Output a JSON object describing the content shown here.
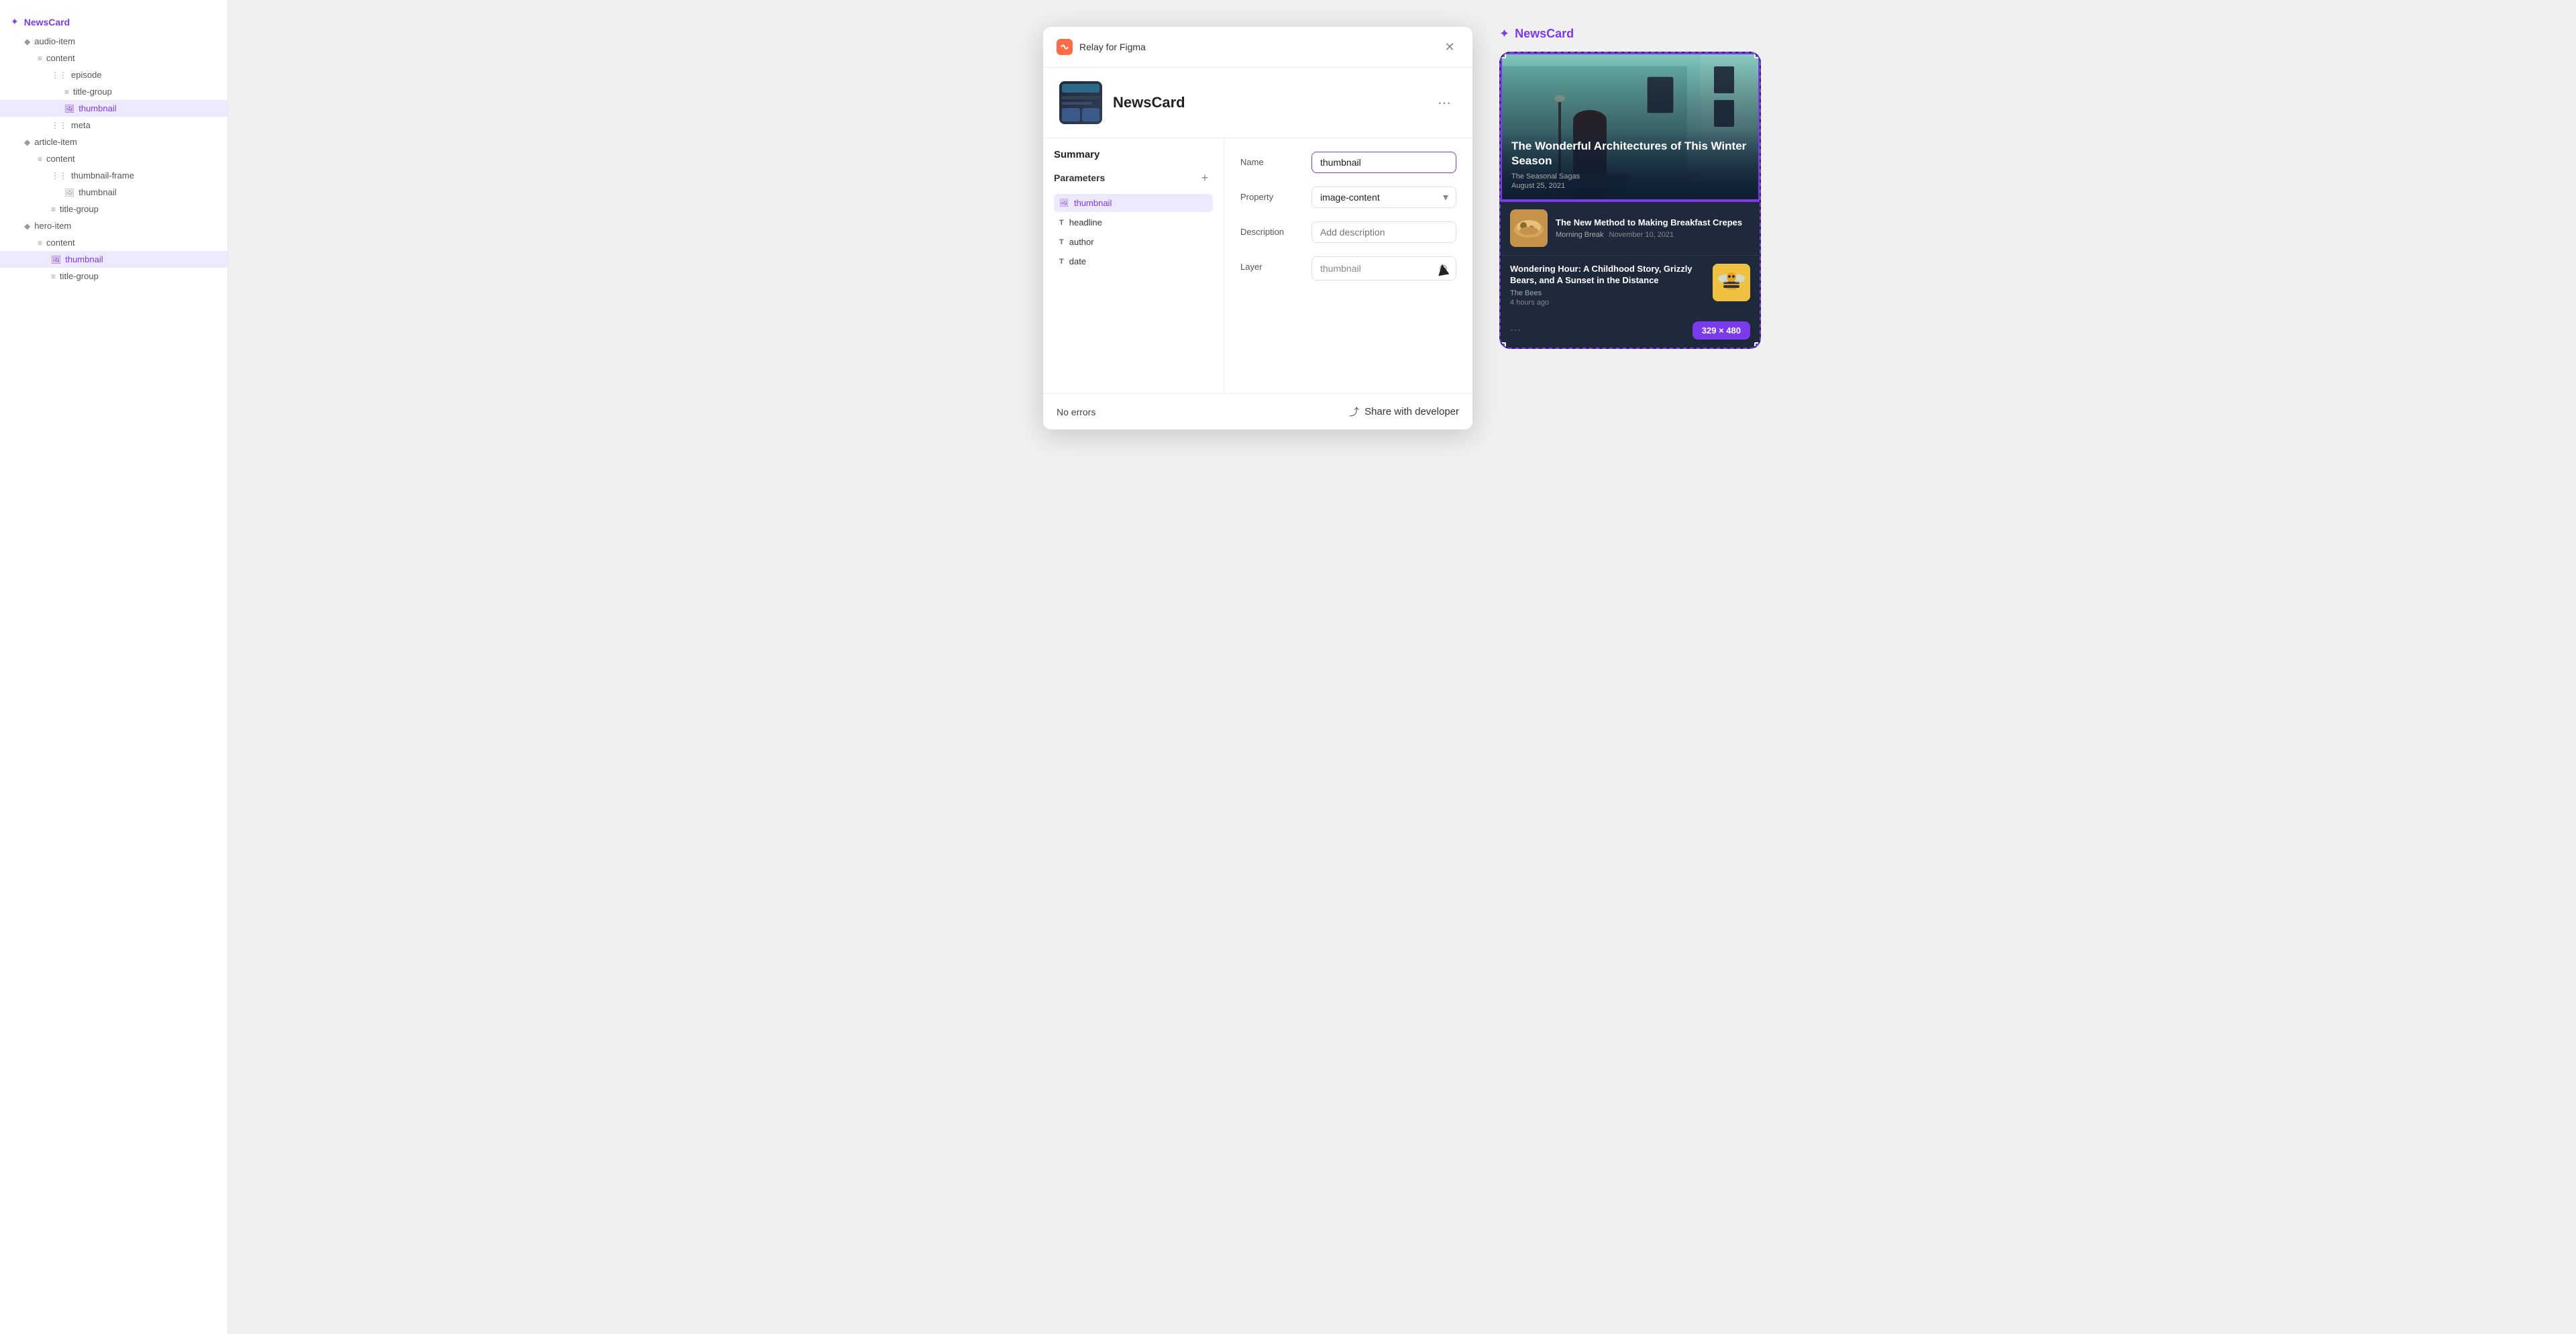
{
  "sidebar": {
    "root_label": "NewsCard",
    "items": [
      {
        "id": "audio-item",
        "label": "audio-item",
        "indent": 1,
        "icon_type": "diamond",
        "active": false
      },
      {
        "id": "content-1",
        "label": "content",
        "indent": 2,
        "icon_type": "lines",
        "active": false
      },
      {
        "id": "episode",
        "label": "episode",
        "indent": 3,
        "icon_type": "bars",
        "active": false
      },
      {
        "id": "title-group-1",
        "label": "title-group",
        "indent": 4,
        "icon_type": "lines",
        "active": false
      },
      {
        "id": "thumbnail-1",
        "label": "thumbnail",
        "indent": 4,
        "icon_type": "image",
        "active": true
      },
      {
        "id": "meta-1",
        "label": "meta",
        "indent": 3,
        "icon_type": "bars",
        "active": false
      },
      {
        "id": "article-item",
        "label": "article-item",
        "indent": 1,
        "icon_type": "diamond",
        "active": false
      },
      {
        "id": "content-2",
        "label": "content",
        "indent": 2,
        "icon_type": "lines",
        "active": false
      },
      {
        "id": "thumbnail-frame",
        "label": "thumbnail-frame",
        "indent": 3,
        "icon_type": "bars",
        "active": false
      },
      {
        "id": "thumbnail-2",
        "label": "thumbnail",
        "indent": 4,
        "icon_type": "image",
        "active": false
      },
      {
        "id": "title-group-2",
        "label": "title-group",
        "indent": 3,
        "icon_type": "lines",
        "active": false
      },
      {
        "id": "hero-item",
        "label": "hero-item",
        "indent": 1,
        "icon_type": "diamond",
        "active": false
      },
      {
        "id": "content-3",
        "label": "content",
        "indent": 2,
        "icon_type": "lines",
        "active": false
      },
      {
        "id": "thumbnail-3",
        "label": "thumbnail",
        "indent": 3,
        "icon_type": "image",
        "active": false
      },
      {
        "id": "title-group-3",
        "label": "title-group",
        "indent": 3,
        "icon_type": "lines",
        "active": false
      }
    ]
  },
  "modal": {
    "header_title": "Relay for Figma",
    "component_name": "NewsCard",
    "tabs": {
      "summary_label": "Summary"
    },
    "params_section": "Parameters",
    "params": [
      {
        "id": "thumbnail",
        "label": "thumbnail",
        "icon_type": "image",
        "active": true
      },
      {
        "id": "headline",
        "label": "headline",
        "icon_type": "text"
      },
      {
        "id": "author",
        "label": "author",
        "icon_type": "text"
      },
      {
        "id": "date",
        "label": "date",
        "icon_type": "text"
      }
    ],
    "fields": {
      "name_label": "Name",
      "name_value": "thumbnail",
      "property_label": "Property",
      "property_value": "image-content",
      "description_label": "Description",
      "description_placeholder": "Add description",
      "layer_label": "Layer",
      "layer_value": "thumbnail"
    },
    "footer": {
      "no_errors": "No errors",
      "share_label": "Share with developer"
    }
  },
  "preview": {
    "title": "NewsCard",
    "hero_headline": "The Wonderful Architectures of This Winter Season",
    "hero_source": "The Seasonal Sagas",
    "hero_date": "August 25, 2021",
    "article2_headline": "The New Method to Making Breakfast Crepes",
    "article2_source": "Morning Break",
    "article2_date": "November 10, 2021",
    "article3_headline": "Wondering Hour: A Childhood Story, Grizzly Bears, and A Sunset in the Distance",
    "article3_source": "The Bees",
    "article3_time": "4 hours ago",
    "size_badge": "329 × 480"
  }
}
